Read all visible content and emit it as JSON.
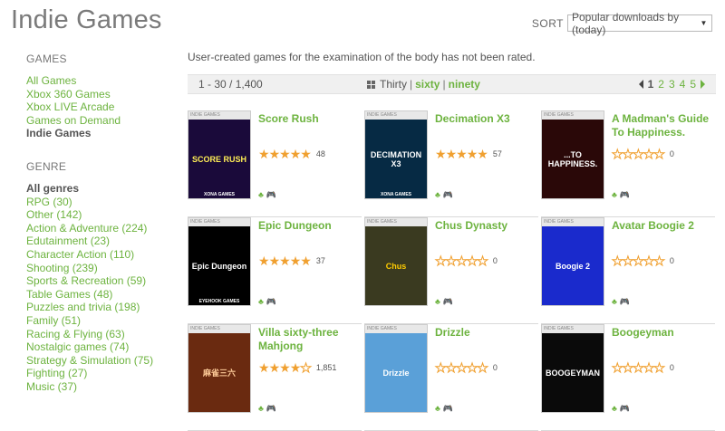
{
  "page_title": "Indie Games",
  "sort": {
    "label": "SORT",
    "value": "Popular downloads by (today)"
  },
  "sidebar": {
    "games_heading": "GAMES",
    "games": [
      {
        "label": "All Games",
        "active": false
      },
      {
        "label": "Xbox 360 Games",
        "active": false
      },
      {
        "label": "Xbox LIVE Arcade",
        "active": false
      },
      {
        "label": "Games on Demand",
        "active": false
      },
      {
        "label": "Indie Games",
        "active": true
      }
    ],
    "genre_heading": "GENRE",
    "genres": [
      {
        "label": "All genres",
        "active": true
      },
      {
        "label": "RPG (30)",
        "active": false
      },
      {
        "label": "Other (142)",
        "active": false
      },
      {
        "label": "Action & Adventure (224)",
        "active": false
      },
      {
        "label": "Edutainment (23)",
        "active": false
      },
      {
        "label": "Character Action (110)",
        "active": false
      },
      {
        "label": "Shooting (239)",
        "active": false
      },
      {
        "label": "Sports & Recreation (59)",
        "active": false
      },
      {
        "label": "Table Games (48)",
        "active": false
      },
      {
        "label": "Puzzles and trivia (198)",
        "active": false
      },
      {
        "label": "Family (51)",
        "active": false
      },
      {
        "label": "Racing & Flying (63)",
        "active": false
      },
      {
        "label": "Nostalgic games (74)",
        "active": false
      },
      {
        "label": "Strategy & Simulation (75)",
        "active": false
      },
      {
        "label": "Fighting (27)",
        "active": false
      },
      {
        "label": "Music (37)",
        "active": false
      }
    ]
  },
  "description": "User-created games for the examination of the body has not been rated.",
  "pager": {
    "range": "1 - 30 / 1,400",
    "view_current": "Thirty",
    "view_sep1": "|",
    "view_opt1": "sixty",
    "view_sep2": "|",
    "view_opt2": "ninety",
    "pages": [
      "1",
      "2",
      "3",
      "4",
      "5"
    ],
    "current_page": "1"
  },
  "games": [
    {
      "title": "Score Rush",
      "stars": 5,
      "count": "48",
      "cover_text": "SCORE RUSH",
      "cover_bg": "#1a0a3a",
      "cover_fg": "#ffee55",
      "cover_label": "XONA GAMES"
    },
    {
      "title": "Decimation X3",
      "stars": 5,
      "count": "57",
      "cover_text": "DECIMATION X3",
      "cover_bg": "#062a44",
      "cover_fg": "#ffffff",
      "cover_label": "XONA GAMES"
    },
    {
      "title": "A Madman's Guide To Happiness.",
      "stars": 0,
      "count": "0",
      "cover_text": "...TO HAPPINESS.",
      "cover_bg": "#2a0808",
      "cover_fg": "#ffffff",
      "cover_label": ""
    },
    {
      "title": "Epic Dungeon",
      "stars": 5,
      "count": "37",
      "cover_text": "Epic Dungeon",
      "cover_bg": "#000000",
      "cover_fg": "#ffffff",
      "cover_label": "EYEHOOK GAMES"
    },
    {
      "title": "Chus Dynasty",
      "stars": 0,
      "count": "0",
      "cover_text": "Chus",
      "cover_bg": "#3a3a20",
      "cover_fg": "#ffcc00",
      "cover_label": ""
    },
    {
      "title": "Avatar Boogie 2",
      "stars": 0,
      "count": "0",
      "cover_text": "Boogie 2",
      "cover_bg": "#1a2acc",
      "cover_fg": "#ffffff",
      "cover_label": ""
    },
    {
      "title": "Villa sixty-three Mahjong",
      "stars": 4,
      "count": "1,851",
      "cover_text": "麻雀三六",
      "cover_bg": "#6a2a10",
      "cover_fg": "#ffcc99",
      "cover_label": ""
    },
    {
      "title": "Drizzle",
      "stars": 0,
      "count": "0",
      "cover_text": "Drizzle",
      "cover_bg": "#5aa0d8",
      "cover_fg": "#ffffff",
      "cover_label": ""
    },
    {
      "title": "Boogeyman",
      "stars": 0,
      "count": "0",
      "cover_text": "BOOGEYMAN",
      "cover_bg": "#0a0a0a",
      "cover_fg": "#ffffff",
      "cover_label": ""
    }
  ],
  "cover_strip": "INDIE GAMES",
  "colors": {
    "accent": "#6db33f",
    "star": "#f0a030",
    "title_gray": "#7a7a7a"
  }
}
